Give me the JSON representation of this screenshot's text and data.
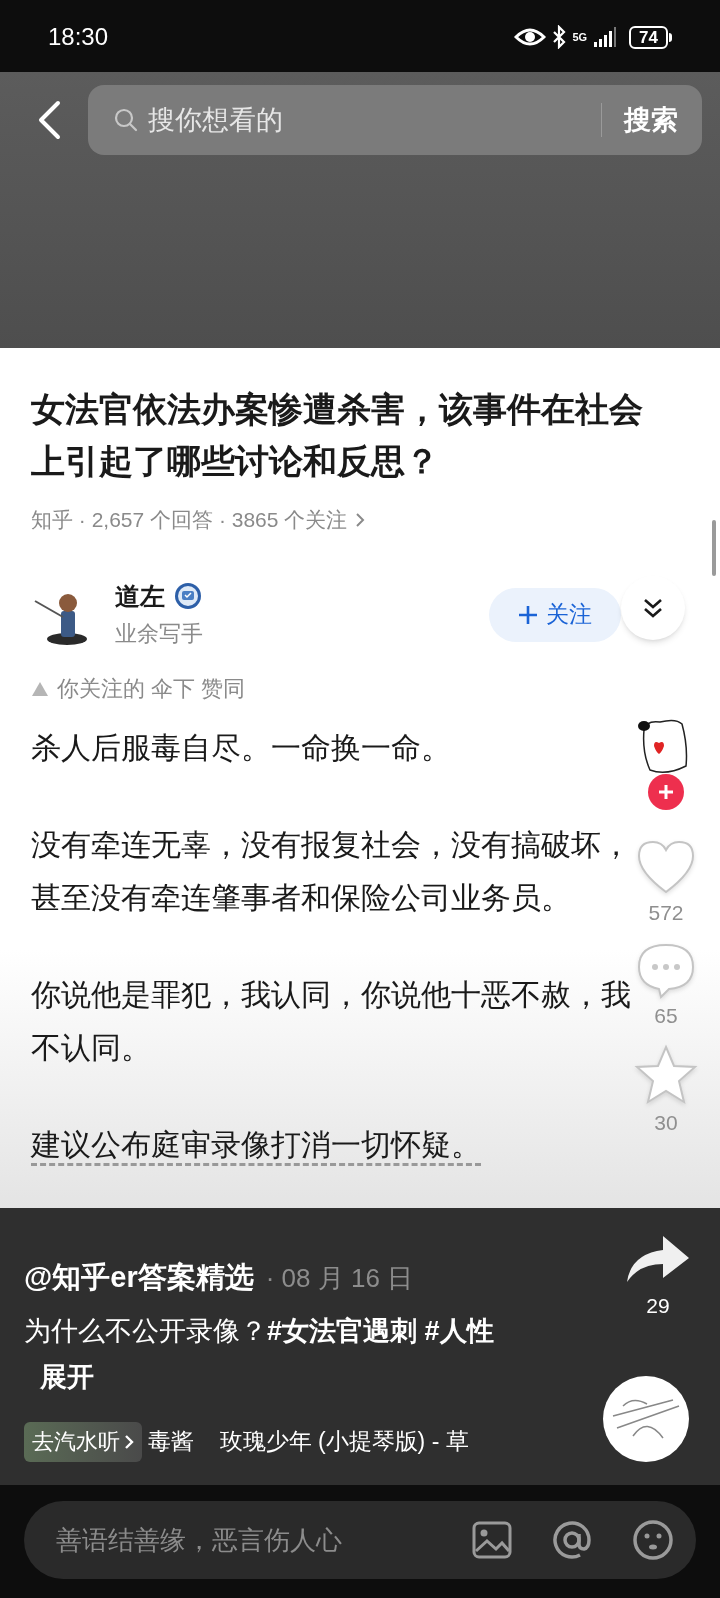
{
  "status_bar": {
    "time": "18:30",
    "network": "5G",
    "battery": "74"
  },
  "search": {
    "placeholder": "搜你想看的",
    "button": "搜索"
  },
  "question": {
    "title": "女法官依法办案惨遭杀害，该事件在社会上引起了哪些讨论和反思？",
    "meta": "知乎 · 2,657 个回答 · 3865 个关注"
  },
  "author": {
    "name": "道左",
    "bio": "业余写手",
    "follow_button": "关注"
  },
  "endorsement": "你关注的 伞下 赞同",
  "paragraphs": [
    {
      "text": "杀人后服毒自尽。一命换一命。",
      "underlined": false
    },
    {
      "text": "没有牵连无辜，没有报复社会，没有搞破坏，甚至没有牵连肇事者和保险公司业务员。",
      "underlined": false
    },
    {
      "text": "你说他是罪犯，我认同，你说他十恶不赦，我不认同。",
      "underlined": false
    },
    {
      "text": "建议公布庭审录像打消一切怀疑。",
      "underlined": true
    }
  ],
  "actions": [
    {
      "kind": "like",
      "count": "572"
    },
    {
      "kind": "comment",
      "count": "65"
    },
    {
      "kind": "favorite",
      "count": "30"
    }
  ],
  "video": {
    "account": "@知乎er答案精选",
    "date": "· 08 月 16 日",
    "caption": "为什么不公开录像？**#女法官遇刺 #人性**",
    "expand": "展开",
    "share_count": "29",
    "music_badge": "去汽水听",
    "music": "毒酱    玫瑰少年 (小提琴版) - 草"
  },
  "comment_box": {
    "placeholder": "善语结善缘，恶言伤人心"
  }
}
